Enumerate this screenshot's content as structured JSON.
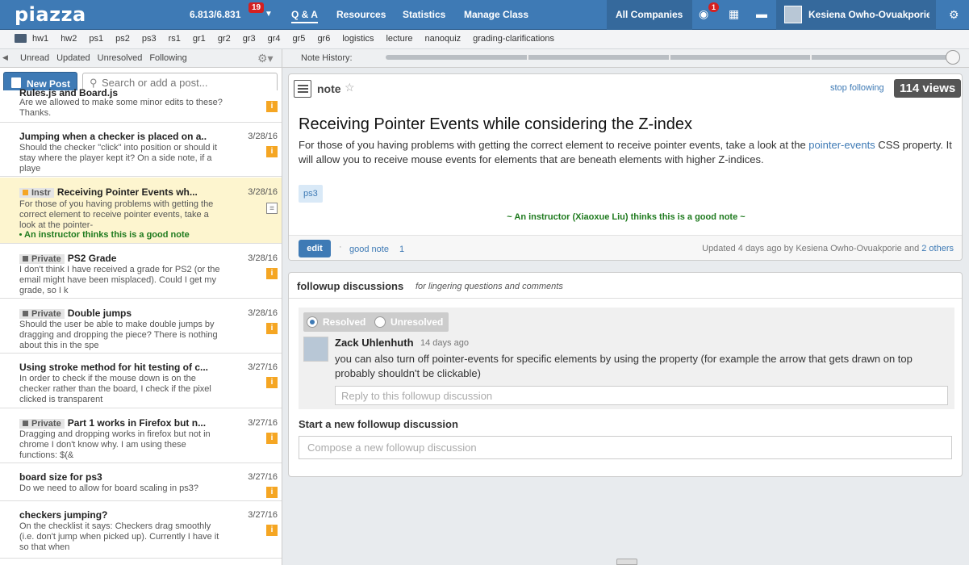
{
  "app": {
    "logo": "piazza"
  },
  "top": {
    "stats": "6.813/6.831",
    "stats_badge": "19",
    "nav": [
      "Q & A",
      "Resources",
      "Statistics",
      "Manage Class"
    ],
    "companies": "All Companies",
    "notif_count": "1",
    "user": "Kesiena Owho-Ovuakporie"
  },
  "folders": [
    "hw1",
    "hw2",
    "ps1",
    "ps2",
    "ps3",
    "rs1",
    "gr1",
    "gr2",
    "gr3",
    "gr4",
    "gr5",
    "gr6",
    "logistics",
    "lecture",
    "nanoquiz",
    "grading-clarifications"
  ],
  "filters": [
    "Unread",
    "Updated",
    "Unresolved",
    "Following"
  ],
  "history_label": "Note History:",
  "left": {
    "new_post": "New Post",
    "search_placeholder": "Search or add a post..."
  },
  "feed": [
    {
      "title": "Rules.js and Board.js",
      "date": "",
      "tag": "",
      "snippet": "Are we allowed to make some minor edits to these? Thanks.",
      "badge": "i"
    },
    {
      "title": "Jumping when a checker is placed on a..",
      "date": "3/28/16",
      "tag": "",
      "snippet": "Should the checker \"click\" into position or should it stay where the player kept it? On a side note, if a playe",
      "badge": "i"
    },
    {
      "title": "Receiving Pointer Events wh...",
      "date": "3/28/16",
      "tag": "Instr",
      "snippet": "For those of you having problems with getting the correct element to receive pointer events, take a look at the pointer-",
      "badge": "note",
      "good": "An instructor thinks this is a good note"
    },
    {
      "title": "PS2 Grade",
      "date": "3/28/16",
      "tag": "Private",
      "snippet": "I don't think I have received a grade for PS2 (or the email might have been misplaced). Could I get my grade, so I k",
      "badge": "i"
    },
    {
      "title": "Double jumps",
      "date": "3/28/16",
      "tag": "Private",
      "snippet": "Should the user be able to make double jumps by dragging and dropping the piece?  There is nothing about this in the spe",
      "badge": "i"
    },
    {
      "title": "Using stroke method for hit testing of c...",
      "date": "3/27/16",
      "tag": "",
      "snippet": "In order to check if the mouse down is on the checker rather than the board, I check if the pixel clicked is transparent",
      "badge": "i"
    },
    {
      "title": "Part 1 works in Firefox but n...",
      "date": "3/27/16",
      "tag": "Private",
      "snippet": "Dragging and dropping works in firefox but not in chrome I don't know why. I am using these functions:          $(&",
      "badge": "i"
    },
    {
      "title": "board size for ps3",
      "date": "3/27/16",
      "tag": "",
      "snippet": "Do we need to allow for board scaling in ps3?",
      "badge": "i"
    },
    {
      "title": "checkers jumping?",
      "date": "3/27/16",
      "tag": "",
      "snippet": "On the checklist it says: Checkers drag smoothly (i.e. don't jump when picked up). Currently I have it so that when",
      "badge": "i"
    }
  ],
  "note": {
    "type": "note",
    "stop_following": "stop following",
    "views": "114 views",
    "title": "Receiving Pointer Events while considering the Z-index",
    "body_1": "For those of you having problems with getting the correct element to receive pointer events, take a look at the ",
    "body_link": "pointer-events",
    "body_2": " CSS property. It will allow you to receive mouse events for elements that are beneath elements with higher Z-indices.",
    "tag": "ps3",
    "good_note_banner": "~ An instructor (Xiaoxue Liu) thinks this is a good note ~",
    "edit": "edit",
    "good_note": "good note",
    "good_count": "1",
    "updated": "Updated 4 days ago by Kesiena Owho-Ovuakporie and ",
    "updated_link": "2 others"
  },
  "followup": {
    "title": "followup discussions",
    "subtitle": "for lingering questions and comments",
    "resolved": "Resolved",
    "unresolved": "Unresolved",
    "author": "Zack Uhlenhuth",
    "time": "14 days ago",
    "message": "you can also turn off pointer-events for specific elements by using the property (for example the arrow that gets drawn on top probably shouldn't be clickable)",
    "reply_placeholder": "Reply to this followup discussion",
    "start_title": "Start a new followup discussion",
    "compose_placeholder": "Compose a new followup discussion"
  }
}
